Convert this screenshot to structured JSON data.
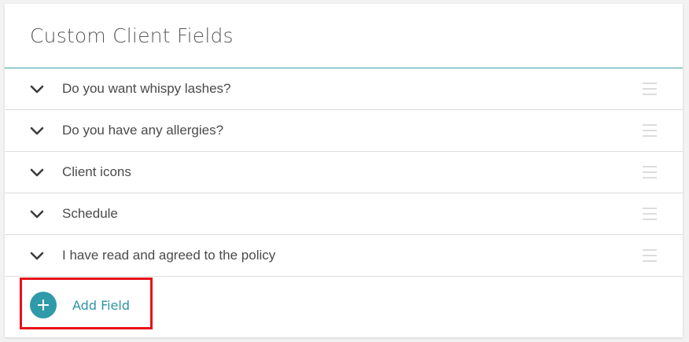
{
  "header": {
    "title": "Custom Client Fields"
  },
  "fields": [
    {
      "label": "Do you want whispy lashes?"
    },
    {
      "label": "Do you have any allergies?"
    },
    {
      "label": "Client icons"
    },
    {
      "label": "Schedule"
    },
    {
      "label": "I have read and agreed to the policy"
    }
  ],
  "add_field": {
    "label": "Add Field",
    "icon": "plus-circle-icon"
  },
  "icons": {
    "expand": "chevron-down-icon",
    "reorder": "drag-handle-icon"
  },
  "colors": {
    "accent": "#2f9aa9",
    "header_rule": "#3a9fa8",
    "highlight": "#e8101a",
    "text": "#4a4a4a"
  }
}
